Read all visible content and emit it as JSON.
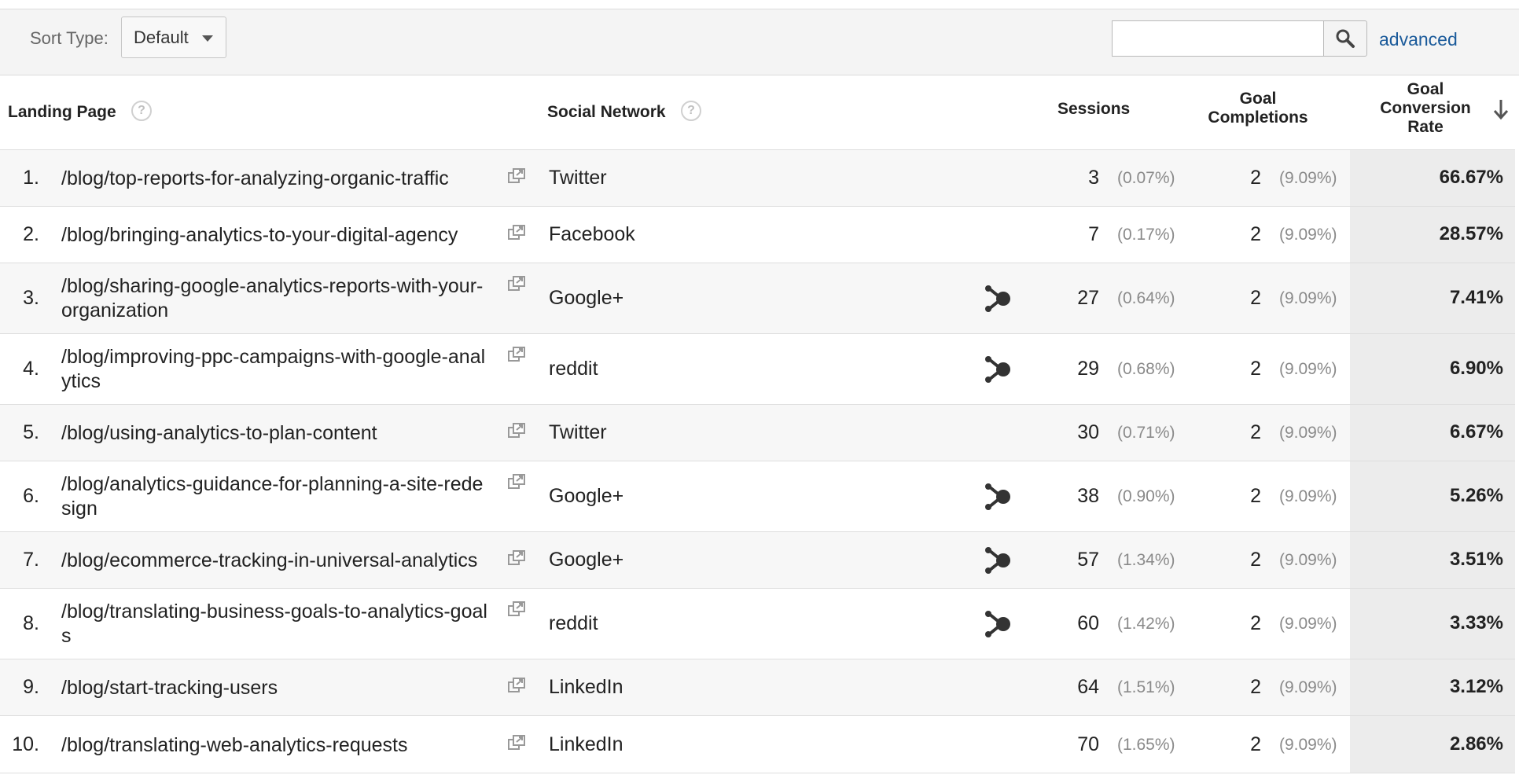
{
  "toolbar": {
    "sort_label": "Sort Type:",
    "sort_value": "Default",
    "search_value": "",
    "advanced_label": "advanced"
  },
  "columns": {
    "landing_page": "Landing Page",
    "social_network": "Social Network",
    "sessions": "Sessions",
    "goal_completions": [
      "Goal",
      "Completions"
    ],
    "goal_conversion_rate": [
      "Goal",
      "Conversion",
      "Rate"
    ],
    "help_glyph": "?"
  },
  "rows": [
    {
      "index": "1.",
      "page": [
        "/blog/top-reports-for-analyzing-organic-traffic"
      ],
      "network": "Twitter",
      "hub": false,
      "sessions": "3",
      "sessions_pct": "(0.07%)",
      "goals": "2",
      "goals_pct": "(9.09%)",
      "rate": "66.67%"
    },
    {
      "index": "2.",
      "page": [
        "/blog/bringing-analytics-to-your-digital-agency"
      ],
      "network": "Facebook",
      "hub": false,
      "sessions": "7",
      "sessions_pct": "(0.17%)",
      "goals": "2",
      "goals_pct": "(9.09%)",
      "rate": "28.57%"
    },
    {
      "index": "3.",
      "page": [
        "/blog/sharing-google-analytics-reports-with-your-",
        "organization"
      ],
      "network": "Google+",
      "hub": true,
      "sessions": "27",
      "sessions_pct": "(0.64%)",
      "goals": "2",
      "goals_pct": "(9.09%)",
      "rate": "7.41%"
    },
    {
      "index": "4.",
      "page": [
        "/blog/improving-ppc-campaigns-with-google-anal",
        "ytics"
      ],
      "network": "reddit",
      "hub": true,
      "sessions": "29",
      "sessions_pct": "(0.68%)",
      "goals": "2",
      "goals_pct": "(9.09%)",
      "rate": "6.90%"
    },
    {
      "index": "5.",
      "page": [
        "/blog/using-analytics-to-plan-content"
      ],
      "network": "Twitter",
      "hub": false,
      "sessions": "30",
      "sessions_pct": "(0.71%)",
      "goals": "2",
      "goals_pct": "(9.09%)",
      "rate": "6.67%"
    },
    {
      "index": "6.",
      "page": [
        "/blog/analytics-guidance-for-planning-a-site-rede",
        "sign"
      ],
      "network": "Google+",
      "hub": true,
      "sessions": "38",
      "sessions_pct": "(0.90%)",
      "goals": "2",
      "goals_pct": "(9.09%)",
      "rate": "5.26%"
    },
    {
      "index": "7.",
      "page": [
        "/blog/ecommerce-tracking-in-universal-analytics"
      ],
      "network": "Google+",
      "hub": true,
      "sessions": "57",
      "sessions_pct": "(1.34%)",
      "goals": "2",
      "goals_pct": "(9.09%)",
      "rate": "3.51%"
    },
    {
      "index": "8.",
      "page": [
        "/blog/translating-business-goals-to-analytics-goal",
        "s"
      ],
      "network": "reddit",
      "hub": true,
      "sessions": "60",
      "sessions_pct": "(1.42%)",
      "goals": "2",
      "goals_pct": "(9.09%)",
      "rate": "3.33%"
    },
    {
      "index": "9.",
      "page": [
        "/blog/start-tracking-users"
      ],
      "network": "LinkedIn",
      "hub": false,
      "sessions": "64",
      "sessions_pct": "(1.51%)",
      "goals": "2",
      "goals_pct": "(9.09%)",
      "rate": "3.12%"
    },
    {
      "index": "10.",
      "page": [
        "/blog/translating-web-analytics-requests"
      ],
      "network": "LinkedIn",
      "hub": false,
      "sessions": "70",
      "sessions_pct": "(1.65%)",
      "goals": "2",
      "goals_pct": "(9.09%)",
      "rate": "2.86%"
    }
  ]
}
